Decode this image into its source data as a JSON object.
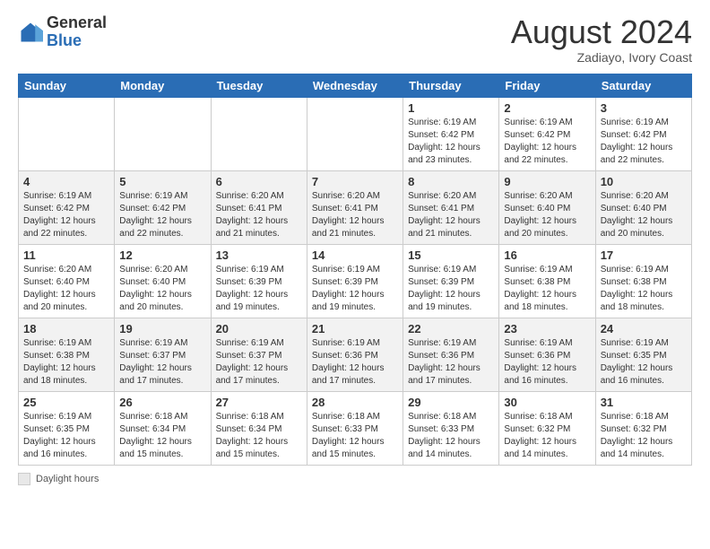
{
  "logo": {
    "general": "General",
    "blue": "Blue"
  },
  "title": "August 2024",
  "location": "Zadiayo, Ivory Coast",
  "days_of_week": [
    "Sunday",
    "Monday",
    "Tuesday",
    "Wednesday",
    "Thursday",
    "Friday",
    "Saturday"
  ],
  "footer": {
    "box_label": "Daylight hours"
  },
  "weeks": [
    [
      {
        "day": "",
        "info": ""
      },
      {
        "day": "",
        "info": ""
      },
      {
        "day": "",
        "info": ""
      },
      {
        "day": "",
        "info": ""
      },
      {
        "day": "1",
        "info": "Sunrise: 6:19 AM\nSunset: 6:42 PM\nDaylight: 12 hours\nand 23 minutes."
      },
      {
        "day": "2",
        "info": "Sunrise: 6:19 AM\nSunset: 6:42 PM\nDaylight: 12 hours\nand 22 minutes."
      },
      {
        "day": "3",
        "info": "Sunrise: 6:19 AM\nSunset: 6:42 PM\nDaylight: 12 hours\nand 22 minutes."
      }
    ],
    [
      {
        "day": "4",
        "info": "Sunrise: 6:19 AM\nSunset: 6:42 PM\nDaylight: 12 hours\nand 22 minutes."
      },
      {
        "day": "5",
        "info": "Sunrise: 6:19 AM\nSunset: 6:42 PM\nDaylight: 12 hours\nand 22 minutes."
      },
      {
        "day": "6",
        "info": "Sunrise: 6:20 AM\nSunset: 6:41 PM\nDaylight: 12 hours\nand 21 minutes."
      },
      {
        "day": "7",
        "info": "Sunrise: 6:20 AM\nSunset: 6:41 PM\nDaylight: 12 hours\nand 21 minutes."
      },
      {
        "day": "8",
        "info": "Sunrise: 6:20 AM\nSunset: 6:41 PM\nDaylight: 12 hours\nand 21 minutes."
      },
      {
        "day": "9",
        "info": "Sunrise: 6:20 AM\nSunset: 6:40 PM\nDaylight: 12 hours\nand 20 minutes."
      },
      {
        "day": "10",
        "info": "Sunrise: 6:20 AM\nSunset: 6:40 PM\nDaylight: 12 hours\nand 20 minutes."
      }
    ],
    [
      {
        "day": "11",
        "info": "Sunrise: 6:20 AM\nSunset: 6:40 PM\nDaylight: 12 hours\nand 20 minutes."
      },
      {
        "day": "12",
        "info": "Sunrise: 6:20 AM\nSunset: 6:40 PM\nDaylight: 12 hours\nand 20 minutes."
      },
      {
        "day": "13",
        "info": "Sunrise: 6:19 AM\nSunset: 6:39 PM\nDaylight: 12 hours\nand 19 minutes."
      },
      {
        "day": "14",
        "info": "Sunrise: 6:19 AM\nSunset: 6:39 PM\nDaylight: 12 hours\nand 19 minutes."
      },
      {
        "day": "15",
        "info": "Sunrise: 6:19 AM\nSunset: 6:39 PM\nDaylight: 12 hours\nand 19 minutes."
      },
      {
        "day": "16",
        "info": "Sunrise: 6:19 AM\nSunset: 6:38 PM\nDaylight: 12 hours\nand 18 minutes."
      },
      {
        "day": "17",
        "info": "Sunrise: 6:19 AM\nSunset: 6:38 PM\nDaylight: 12 hours\nand 18 minutes."
      }
    ],
    [
      {
        "day": "18",
        "info": "Sunrise: 6:19 AM\nSunset: 6:38 PM\nDaylight: 12 hours\nand 18 minutes."
      },
      {
        "day": "19",
        "info": "Sunrise: 6:19 AM\nSunset: 6:37 PM\nDaylight: 12 hours\nand 17 minutes."
      },
      {
        "day": "20",
        "info": "Sunrise: 6:19 AM\nSunset: 6:37 PM\nDaylight: 12 hours\nand 17 minutes."
      },
      {
        "day": "21",
        "info": "Sunrise: 6:19 AM\nSunset: 6:36 PM\nDaylight: 12 hours\nand 17 minutes."
      },
      {
        "day": "22",
        "info": "Sunrise: 6:19 AM\nSunset: 6:36 PM\nDaylight: 12 hours\nand 17 minutes."
      },
      {
        "day": "23",
        "info": "Sunrise: 6:19 AM\nSunset: 6:36 PM\nDaylight: 12 hours\nand 16 minutes."
      },
      {
        "day": "24",
        "info": "Sunrise: 6:19 AM\nSunset: 6:35 PM\nDaylight: 12 hours\nand 16 minutes."
      }
    ],
    [
      {
        "day": "25",
        "info": "Sunrise: 6:19 AM\nSunset: 6:35 PM\nDaylight: 12 hours\nand 16 minutes."
      },
      {
        "day": "26",
        "info": "Sunrise: 6:18 AM\nSunset: 6:34 PM\nDaylight: 12 hours\nand 15 minutes."
      },
      {
        "day": "27",
        "info": "Sunrise: 6:18 AM\nSunset: 6:34 PM\nDaylight: 12 hours\nand 15 minutes."
      },
      {
        "day": "28",
        "info": "Sunrise: 6:18 AM\nSunset: 6:33 PM\nDaylight: 12 hours\nand 15 minutes."
      },
      {
        "day": "29",
        "info": "Sunrise: 6:18 AM\nSunset: 6:33 PM\nDaylight: 12 hours\nand 14 minutes."
      },
      {
        "day": "30",
        "info": "Sunrise: 6:18 AM\nSunset: 6:32 PM\nDaylight: 12 hours\nand 14 minutes."
      },
      {
        "day": "31",
        "info": "Sunrise: 6:18 AM\nSunset: 6:32 PM\nDaylight: 12 hours\nand 14 minutes."
      }
    ]
  ]
}
